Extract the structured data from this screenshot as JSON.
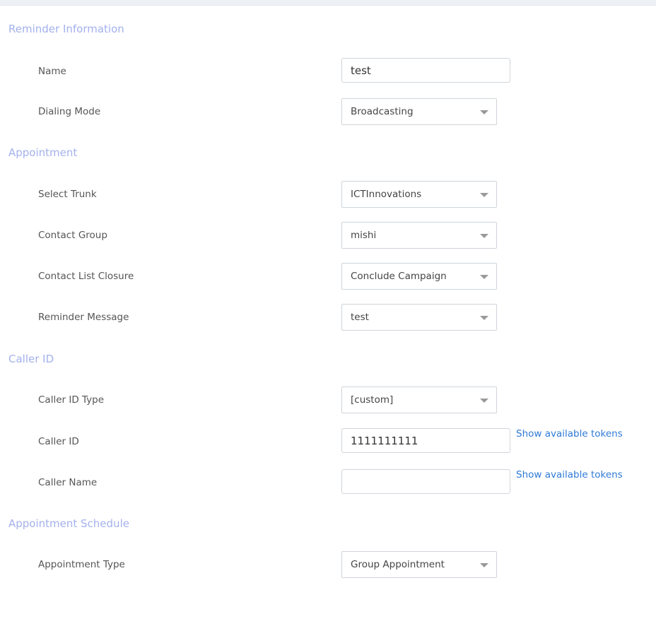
{
  "sections": {
    "reminder_info": "Reminder Information",
    "appointment": "Appointment",
    "caller_id": "Caller ID",
    "schedule": "Appointment Schedule"
  },
  "fields": {
    "name": {
      "label": "Name",
      "value": "test"
    },
    "dialing_mode": {
      "label": "Dialing Mode",
      "value": "Broadcasting"
    },
    "select_trunk": {
      "label": "Select Trunk",
      "value": "ICTInnovations"
    },
    "contact_group": {
      "label": "Contact Group",
      "value": "mishi"
    },
    "contact_list_closure": {
      "label": "Contact List Closure",
      "value": "Conclude Campaign"
    },
    "reminder_message": {
      "label": "Reminder Message",
      "value": "test"
    },
    "caller_id_type": {
      "label": "Caller ID Type",
      "value": "[custom]"
    },
    "caller_id": {
      "label": "Caller ID",
      "value": "1111111111",
      "link": "Show available tokens"
    },
    "caller_name": {
      "label": "Caller Name",
      "value": "",
      "link": "Show available tokens"
    },
    "appointment_type": {
      "label": "Appointment Type",
      "value": "Group Appointment"
    }
  }
}
